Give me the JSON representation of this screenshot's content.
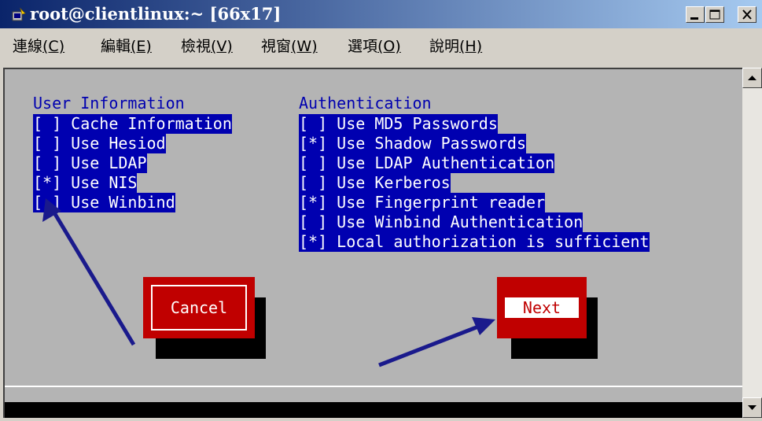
{
  "window": {
    "title": "root@clientlinux:~ [66x17]",
    "controls": [
      "minimize",
      "maximize",
      "close"
    ]
  },
  "menu": [
    {
      "label": "連線",
      "accel": "(C)"
    },
    {
      "label": "編輯",
      "accel": "(E)"
    },
    {
      "label": "檢視",
      "accel": "(V)"
    },
    {
      "label": "視窗",
      "accel": "(W)"
    },
    {
      "label": "選項",
      "accel": "(O)"
    },
    {
      "label": "說明",
      "accel": "(H)"
    }
  ],
  "user_info": {
    "heading": "User Information",
    "options": [
      {
        "mark": "[ ]",
        "label": "Cache Information"
      },
      {
        "mark": "[ ]",
        "label": "Use Hesiod"
      },
      {
        "mark": "[ ]",
        "label": "Use LDAP"
      },
      {
        "mark": "[*]",
        "label": "Use NIS"
      },
      {
        "mark": "[ ]",
        "label": "Use Winbind"
      }
    ]
  },
  "authentication": {
    "heading": "Authentication",
    "options": [
      {
        "mark": "[ ]",
        "label": "Use MD5 Passwords"
      },
      {
        "mark": "[*]",
        "label": "Use Shadow Passwords"
      },
      {
        "mark": "[ ]",
        "label": "Use LDAP Authentication"
      },
      {
        "mark": "[ ]",
        "label": "Use Kerberos"
      },
      {
        "mark": "[*]",
        "label": "Use Fingerprint reader"
      },
      {
        "mark": "[ ]",
        "label": "Use Winbind Authentication"
      },
      {
        "mark": "[*]",
        "label": "Local authorization is sufficient"
      }
    ]
  },
  "buttons": {
    "cancel": "Cancel",
    "next": "Next"
  },
  "colors": {
    "terminal_bg": "#b4b4b4",
    "option_bg": "#0000b0",
    "button_red": "#c00000",
    "annotation_arrow": "#1a1a8c"
  }
}
